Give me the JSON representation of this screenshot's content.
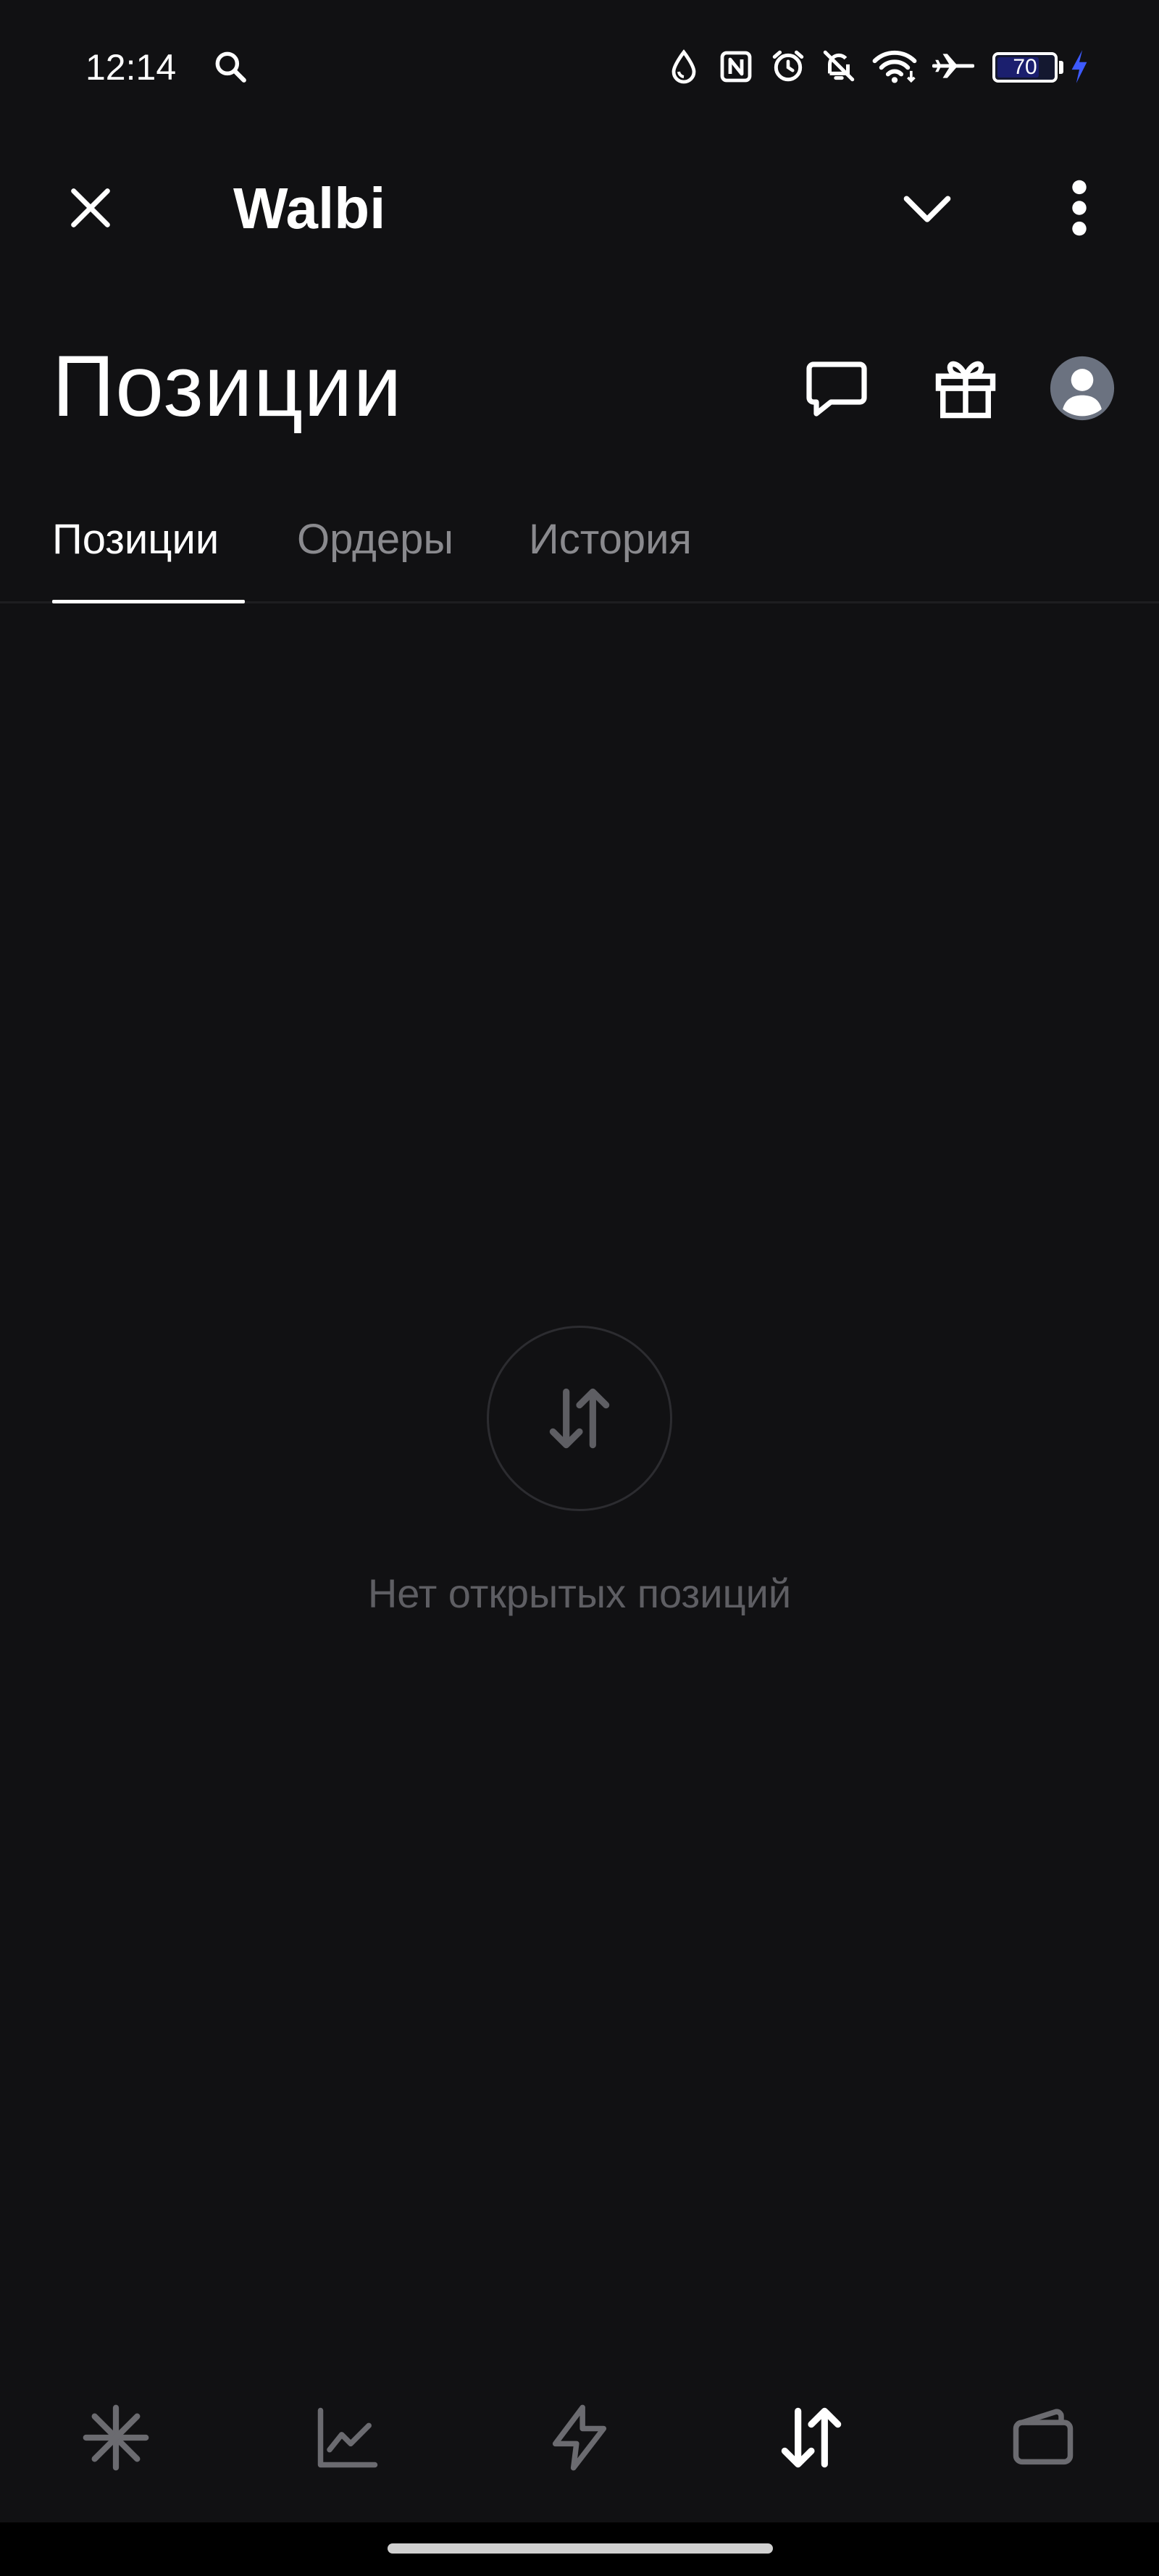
{
  "status_bar": {
    "time": "12:14",
    "battery_level": "70",
    "icons": [
      "search-icon",
      "drop-icon",
      "nfc-icon",
      "alarm-icon",
      "bell-off-icon",
      "wifi-icon",
      "airplane-icon",
      "battery-icon",
      "charging-icon"
    ]
  },
  "app_bar": {
    "title": "Walbi",
    "icons": [
      "close-icon",
      "chevron-down-icon",
      "more-vert-icon"
    ]
  },
  "header": {
    "title": "Позиции",
    "icons": [
      "chat-icon",
      "gift-icon",
      "profile-avatar-icon"
    ]
  },
  "tabs": [
    {
      "label": "Позиции",
      "active": true
    },
    {
      "label": "Ордеры",
      "active": false
    },
    {
      "label": "История",
      "active": false
    }
  ],
  "empty_state": {
    "icon": "swap-vertical-icon",
    "message": "Нет открытых позиций"
  },
  "bottom_nav": {
    "items": [
      {
        "icon": "sparkle-icon",
        "active": false
      },
      {
        "icon": "chart-icon",
        "active": false
      },
      {
        "icon": "lightning-icon",
        "active": false
      },
      {
        "icon": "swap-vertical-icon",
        "active": true
      },
      {
        "icon": "wallet-icon",
        "active": false
      }
    ]
  },
  "colors": {
    "background": "#111113",
    "text_primary": "#ffffff",
    "text_secondary": "#8a8a8e",
    "text_muted": "#5e5e63",
    "battery_fill": "#1b1f6e",
    "charging_bolt": "#3d5afe"
  }
}
